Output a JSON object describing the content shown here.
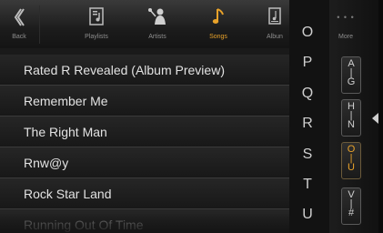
{
  "toolbar": {
    "items": [
      {
        "label": "Back",
        "icon": "back-chevron-icon",
        "active": false
      },
      {
        "label": "Playlists",
        "icon": "playlist-icon",
        "active": false
      },
      {
        "label": "Artists",
        "icon": "artist-icon",
        "active": false
      },
      {
        "label": "Songs",
        "icon": "music-note-icon",
        "active": true
      },
      {
        "label": "Albun",
        "icon": "album-icon",
        "active": false
      }
    ],
    "more_label": "More",
    "more_dots": "• • •",
    "accent_color": "#e8a22a"
  },
  "songs": [
    "Rated R Revealed (Album Preview)",
    "Remember Me",
    "The Right Man",
    "Rnw@y",
    "Rock Star Land",
    "Running Out Of Time"
  ],
  "index_letters": [
    "O",
    "P",
    "Q",
    "R",
    "S",
    "T",
    "U"
  ],
  "letter_groups": [
    {
      "top": "A",
      "mid": "|",
      "bottom": "G",
      "active": false
    },
    {
      "top": "H",
      "mid": "|",
      "bottom": "N",
      "active": false
    },
    {
      "top": "O",
      "mid": "|",
      "bottom": "U",
      "active": true
    },
    {
      "top": "V",
      "mid": "|",
      "bottom": "#",
      "active": false
    }
  ]
}
